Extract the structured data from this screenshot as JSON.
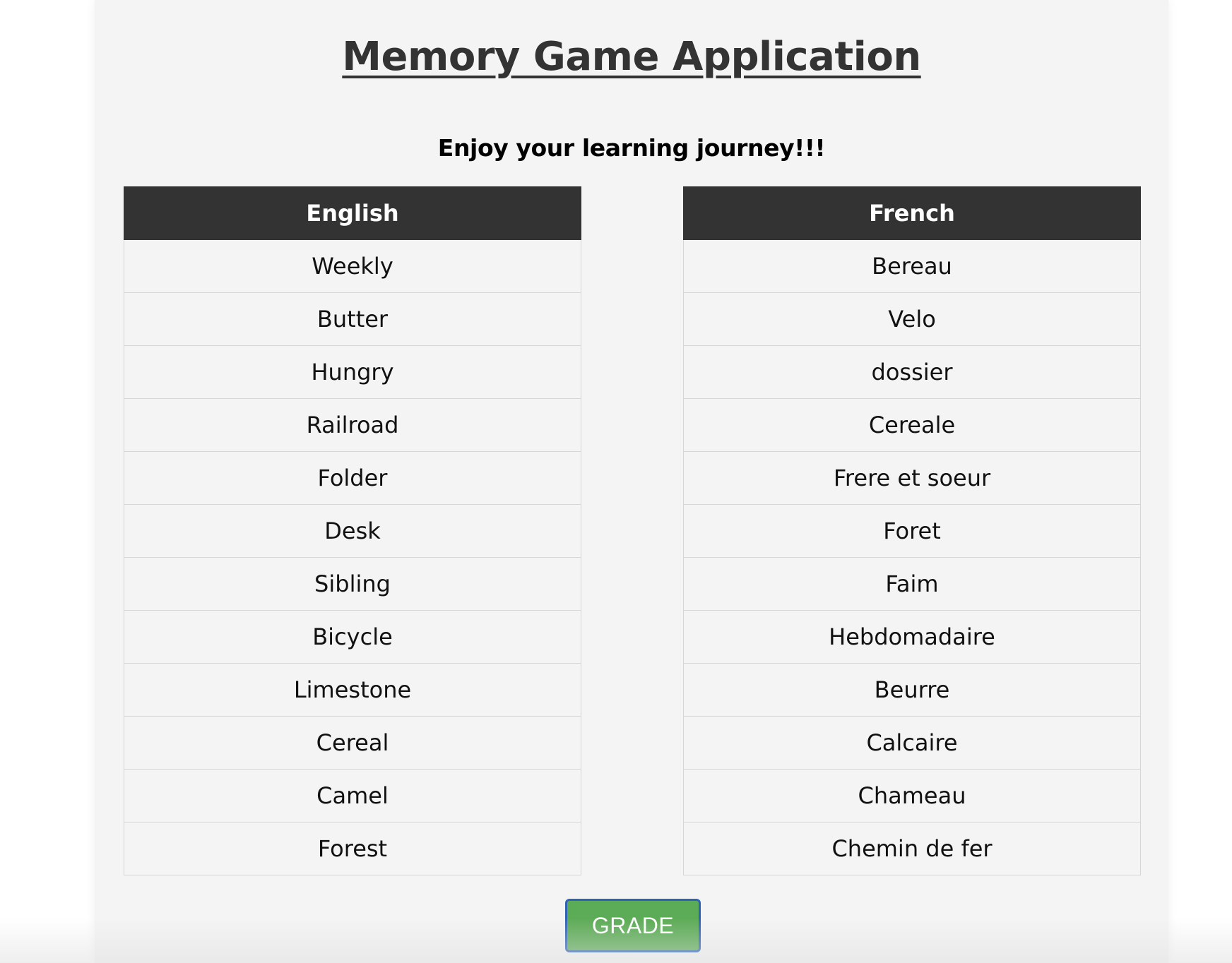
{
  "header": {
    "title": "Memory Game Application",
    "subtitle": "Enjoy your learning journey!!!"
  },
  "english_table": {
    "header": "English",
    "rows": [
      "Weekly",
      "Butter",
      "Hungry",
      "Railroad",
      "Folder",
      "Desk",
      "Sibling",
      "Bicycle",
      "Limestone",
      "Cereal",
      "Camel",
      "Forest"
    ]
  },
  "french_table": {
    "header": "French",
    "rows": [
      "Bereau",
      "Velo",
      "dossier",
      "Cereale",
      "Frere et soeur",
      "Foret",
      "Faim",
      "Hebdomadaire",
      "Beurre",
      "Calcaire",
      "Chameau",
      "Chemin de fer"
    ]
  },
  "actions": {
    "grade_label": "GRADE"
  },
  "colors": {
    "table_header_bg": "#333333",
    "page_bg": "#f4f4f4",
    "grade_button_bg": "#5cab56",
    "grade_button_border": "#2f62b5"
  }
}
